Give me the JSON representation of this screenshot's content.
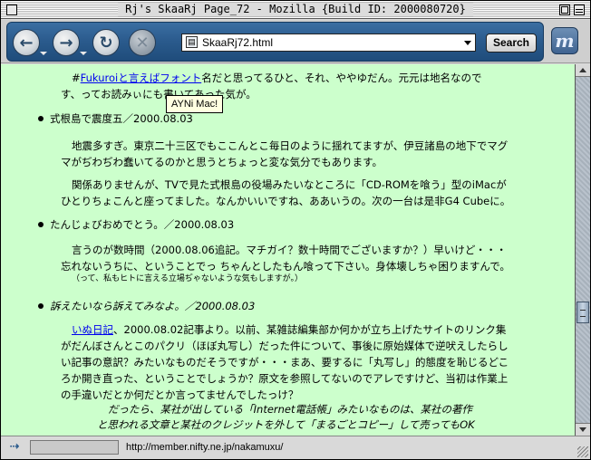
{
  "window": {
    "title": "Rj's SkaaRj Page_72 - Mozilla {Build ID: 2000080720}"
  },
  "toolbar": {
    "back_icon": "←",
    "forward_icon": "→",
    "reload_icon": "↻",
    "stop_icon": "✕",
    "url": "SkaaRj72.html",
    "search_label": "Search",
    "logo_glyph": "m"
  },
  "content": {
    "intro": {
      "prefix": "#",
      "link": "Fukuroiと言えばフォント",
      "suffix": "名だと思ってるひと、それ、ややゆだん。元元は地名なので",
      "line2": "す、ってお読みぃにも書いてあった気が。"
    },
    "tooltip": "AYNi Mac!",
    "items": [
      {
        "heading": "式根島で震度五／2000.08.03",
        "p1": [
          "地震多すぎ。東京二十三区でもここんとこ毎日のように揺れてますが、伊豆諸島の地下でマグ",
          "マがぢわぢわ蠢いてるのかと思うとちょっと変な気分でもあります。"
        ],
        "p2": [
          "関係ありませんが、TVで見た式根島の役場みたいなところに「CD-ROMを喰う」型のiMacが",
          "ひとりちょこんと座ってました。なんかいいですね、ああいうの。次の一台は是非G4 Cubeに。"
        ]
      },
      {
        "heading": "たんじょびおめでとう。／2000.08.03",
        "p1": [
          "言うのが数時間（2000.08.06追記。マチガイ？数十時間でございますか？）早いけど・・・",
          "忘れないうちに、ということでっ ちゃんとしたもん喰って下さい。身体壊しちゃ困りますんで。"
        ],
        "small": "（って、私もヒトに言える立場ぢゃないような気もしますが。）"
      },
      {
        "heading": "訴えたいなら訴えてみなよ。／2000.08.03",
        "p1_link": "いぬ日記",
        "p1": [
          "、2000.08.02記事より。以前、某雑誌編集部か何かが立ち上げたサイトのリンク集",
          "がだんぼさんとこのパクリ（ほぼ丸写し）だった件について、事後に原始媒体で逆吠えしたらし",
          "い記事の意訳？みたいなものだそうですが・・・まあ、要するに「丸写し」的態度を恥じるどこ",
          "ろか開き直った、ということでしょうか？原文を参照してないのでアレですけど、当初は作業上",
          "の手違いだとか何だとか言ってませんでしたっけ？"
        ],
        "quote": [
          "だったら、某社が出している「Internet電話帳」みたいなものは、某社の著作",
          "と思われる文章と某社のクレジットを外して「まるごとコピー」して売ってもOK"
        ]
      }
    ]
  },
  "statusbar": {
    "text": "http://member.nifty.ne.jp/nakamuxu/"
  }
}
